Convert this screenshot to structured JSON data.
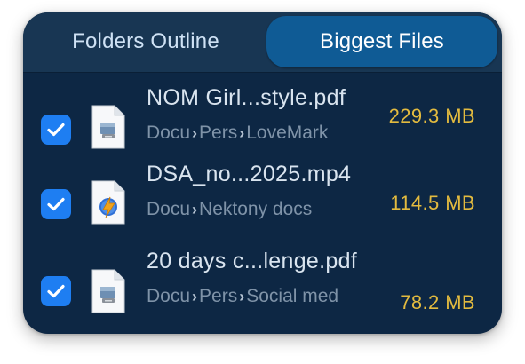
{
  "tabs": {
    "folders_label": "Folders Outline",
    "biggest_label": "Biggest Files",
    "active": "Biggest Files"
  },
  "colors": {
    "panel_bg": "#0d2744",
    "active_tab": "#0f5b95",
    "checkbox": "#1e7ef2",
    "size_text": "#e3bb3f"
  },
  "files": [
    {
      "checked": true,
      "icon": "pdf-file-icon",
      "name": "NOM Girl...style.pdf",
      "path": [
        "Documents",
        "Personal",
        "LoveMarks"
      ],
      "path_visible": [
        "Docu",
        "Pers",
        "LoveMark"
      ],
      "size": "229.3 MB"
    },
    {
      "checked": true,
      "icon": "video-file-icon",
      "name": "DSA_no...2025.mp4",
      "path": [
        "Documents",
        "Nektony docs"
      ],
      "path_visible": [
        "Docu",
        "Nektony docs"
      ],
      "size": "114.5 MB"
    },
    {
      "checked": true,
      "icon": "pdf-file-icon",
      "name": "20 days c...lenge.pdf",
      "path": [
        "Documents",
        "Personal",
        "Social media"
      ],
      "path_visible": [
        "Docu",
        "Pers",
        "Social med"
      ],
      "size": "78.2 MB"
    }
  ]
}
